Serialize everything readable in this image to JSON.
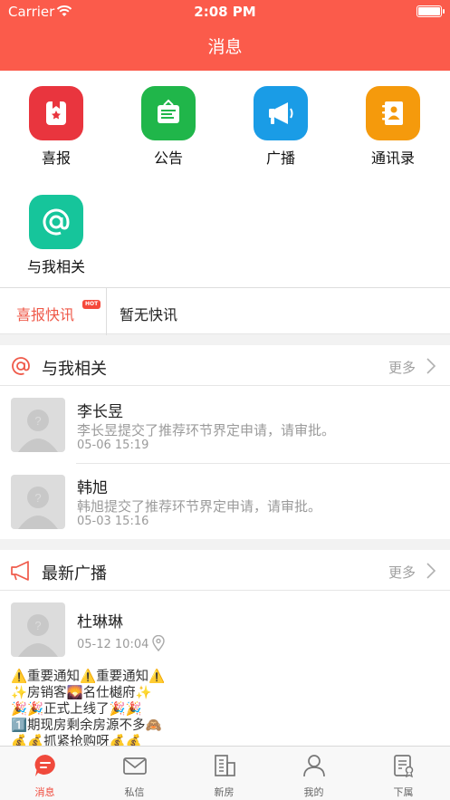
{
  "status_bar": {
    "carrier": "Carrier",
    "time": "2:08 PM"
  },
  "header": {
    "title": "消息"
  },
  "apps": [
    {
      "label": "喜报",
      "icon": "report-icon",
      "color": "#e9353e"
    },
    {
      "label": "公告",
      "icon": "notice-board-icon",
      "color": "#20b64a"
    },
    {
      "label": "广播",
      "icon": "megaphone-icon",
      "color": "#1a9ce6"
    },
    {
      "label": "通讯录",
      "icon": "contacts-book-icon",
      "color": "#f59a0c"
    },
    {
      "label": "与我相关",
      "icon": "at-sign-icon",
      "color": "#16c59b"
    }
  ],
  "flash": {
    "tag": "喜报快讯",
    "badge": "HOT",
    "message": "暂无快讯"
  },
  "related": {
    "title": "与我相关",
    "more": "更多",
    "items": [
      {
        "name": "李长昱",
        "desc": "李长昱提交了推荐环节界定申请，请审批。",
        "time": "05-06 15:19"
      },
      {
        "name": "韩旭",
        "desc": "韩旭提交了推荐环节界定申请，请审批。",
        "time": "05-03 15:16"
      }
    ]
  },
  "broadcast": {
    "title": "最新广播",
    "more": "更多",
    "post": {
      "name": "杜琳琳",
      "time": "05-12 10:04",
      "lines": [
        "⚠️重要通知⚠️重要通知⚠️",
        "✨房销客🌄名仕樾府✨",
        "🎉🎉正式上线了🎉🎉",
        "1️⃣期现房剩余房源不多🙈",
        "💰💰抓紧抢购呀💰💰"
      ]
    }
  },
  "tabbar": [
    {
      "label": "消息",
      "icon": "chat-bubble-icon",
      "active": true
    },
    {
      "label": "私信",
      "icon": "envelope-icon",
      "active": false
    },
    {
      "label": "新房",
      "icon": "building-icon",
      "active": false
    },
    {
      "label": "我的",
      "icon": "person-icon",
      "active": false
    },
    {
      "label": "下属",
      "icon": "subordinate-doc-icon",
      "active": false
    }
  ],
  "colors": {
    "brand": "#fb5b4b",
    "accent": "#f04a3c"
  }
}
